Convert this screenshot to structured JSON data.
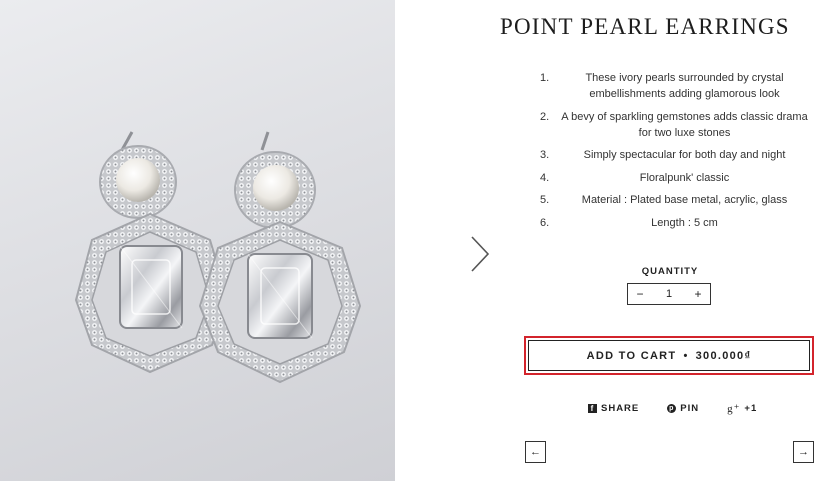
{
  "product": {
    "title": "POINT PEARL EARRINGS",
    "image_alt": "Point pearl earrings with crystal embellishments",
    "features": [
      {
        "num": "1.",
        "text": "These ivory pearls surrounded by crystal embellishments adding glamorous look"
      },
      {
        "num": "2.",
        "text": "A bevy of sparkling gemstones adds classic drama for two luxe stones"
      },
      {
        "num": "3.",
        "text": "Simply spectacular for both day and night"
      },
      {
        "num": "4.",
        "text": "Floralpunk' classic"
      },
      {
        "num": "5.",
        "text": "Material : Plated base metal, acrylic, glass"
      },
      {
        "num": "6.",
        "text": "Length : 5 cm"
      }
    ]
  },
  "quantity": {
    "label": "QUANTITY",
    "value": "1",
    "minus": "−",
    "plus": "+"
  },
  "cart": {
    "label": "ADD TO CART",
    "separator": "•",
    "price": "300.000₫",
    "highlight_color": "#d3242c"
  },
  "share": {
    "facebook_label": "SHARE",
    "facebook_icon": "f",
    "pinterest_label": "PIN",
    "pinterest_icon": "p",
    "gplus_icon": "g⁺",
    "gplus_label": "+1"
  },
  "nav": {
    "prev": "←",
    "next": "→"
  }
}
